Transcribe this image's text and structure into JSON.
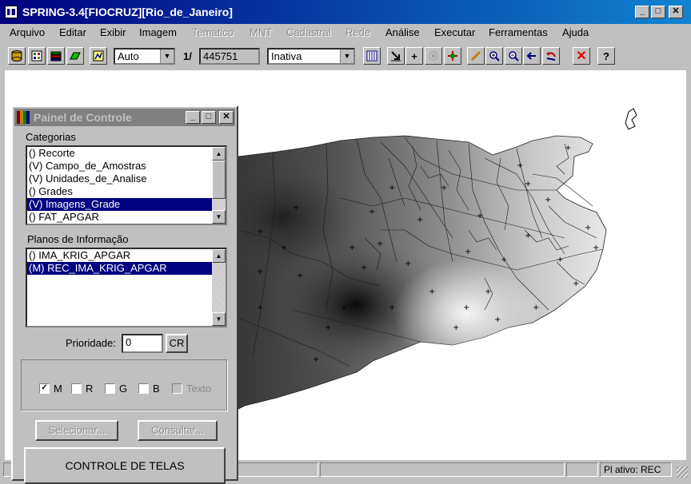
{
  "window": {
    "title": "SPRING-3.4[FIOCRUZ][Rio_de_Janeiro]"
  },
  "menu": [
    {
      "label": "Arquivo",
      "enabled": true
    },
    {
      "label": "Editar",
      "enabled": true
    },
    {
      "label": "Exibir",
      "enabled": true
    },
    {
      "label": "Imagem",
      "enabled": true
    },
    {
      "label": "Temático",
      "enabled": false
    },
    {
      "label": "MNT",
      "enabled": false
    },
    {
      "label": "Cadastral",
      "enabled": false
    },
    {
      "label": "Rede",
      "enabled": false
    },
    {
      "label": "Análise",
      "enabled": true
    },
    {
      "label": "Executar",
      "enabled": true
    },
    {
      "label": "Ferramentas",
      "enabled": true
    },
    {
      "label": "Ajuda",
      "enabled": true
    }
  ],
  "toolbar": {
    "zoom_mode": "Auto",
    "scale_prefix": "1/",
    "scale_value": "445751",
    "status_combo": "Inativa",
    "icons": [
      "database-icon",
      "image-icon",
      "layers-icon",
      "plane-icon",
      "draw-icon",
      "display-icon",
      "cursor-icon",
      "plus-icon",
      "info-icon",
      "pan-icon",
      "ruler-icon",
      "zoom-in-icon",
      "zoom-out-icon",
      "back-icon",
      "undo-icon",
      "close-icon",
      "help-icon"
    ]
  },
  "panel": {
    "title": "Painel de Controle",
    "categories_label": "Categorias",
    "categories": [
      "() Recorte",
      "(V) Campo_de_Amostras",
      "(V) Unidades_de_Analise",
      "() Grades",
      "(V) Imagens_Grade",
      "() FAT_APGAR"
    ],
    "categories_selected": 4,
    "planes_label": "Planos de Informação",
    "planes": [
      "() IMA_KRIG_APGAR",
      "(M) REC_IMA_KRIG_APGAR"
    ],
    "planes_selected": 1,
    "priority_label": "Prioridade:",
    "priority_value": "0",
    "cr_button": "CR",
    "checkboxes": [
      {
        "label": "M",
        "checked": true,
        "enabled": true
      },
      {
        "label": "R",
        "checked": false,
        "enabled": true
      },
      {
        "label": "G",
        "checked": false,
        "enabled": true
      },
      {
        "label": "B",
        "checked": false,
        "enabled": true
      },
      {
        "label": "Texto",
        "checked": false,
        "enabled": false
      }
    ],
    "select_button": "Selecionar...",
    "query_button": "Consultar...",
    "screens_button": "CONTROLE DE TELAS"
  },
  "status": {
    "active_plan": "Pl ativo: REC"
  },
  "colors": {
    "title_active": "#000080",
    "selection": "#000080",
    "face": "#c0c0c0"
  }
}
